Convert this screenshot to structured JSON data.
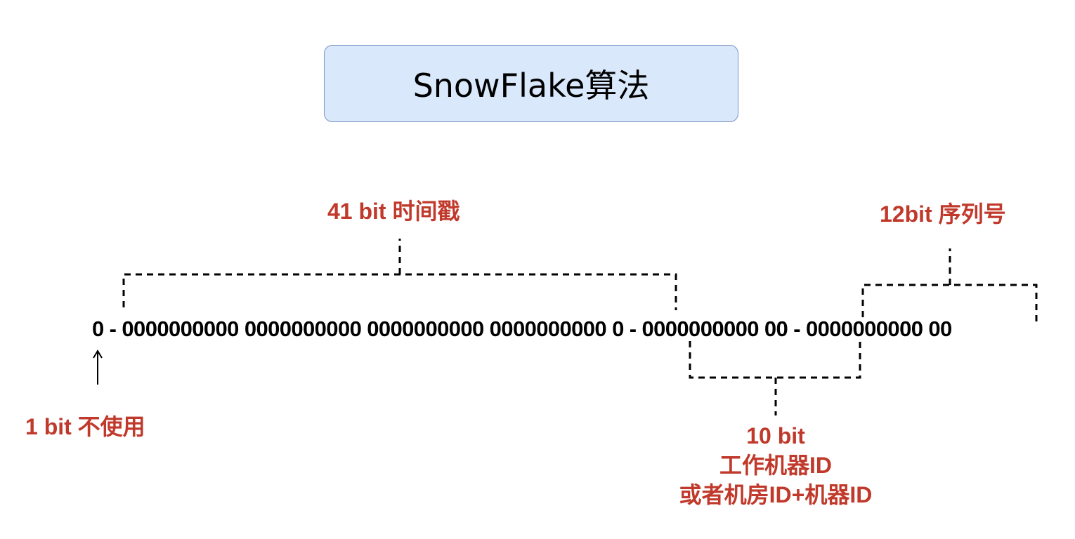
{
  "title": "SnowFlake算法",
  "bit_groups": {
    "sign_bit": "0",
    "sep1": " - ",
    "timestamp": "0000000000 0000000000 0000000000 0000000000 0",
    "sep2": " - ",
    "machine": "0000000000 00",
    "sep3": " - ",
    "sequence": "0000000000 00"
  },
  "labels": {
    "timestamp": "41 bit 时间戳",
    "sequence": "12bit 序列号",
    "unused": "1 bit 不使用",
    "machine_line1": "10 bit",
    "machine_line2": "工作机器ID",
    "machine_line3": "或者机房ID+机器ID"
  },
  "colors": {
    "label": "#c0392b",
    "title_fill": "#dae8fc",
    "title_border": "#7a94c2",
    "bits": "#000000"
  }
}
